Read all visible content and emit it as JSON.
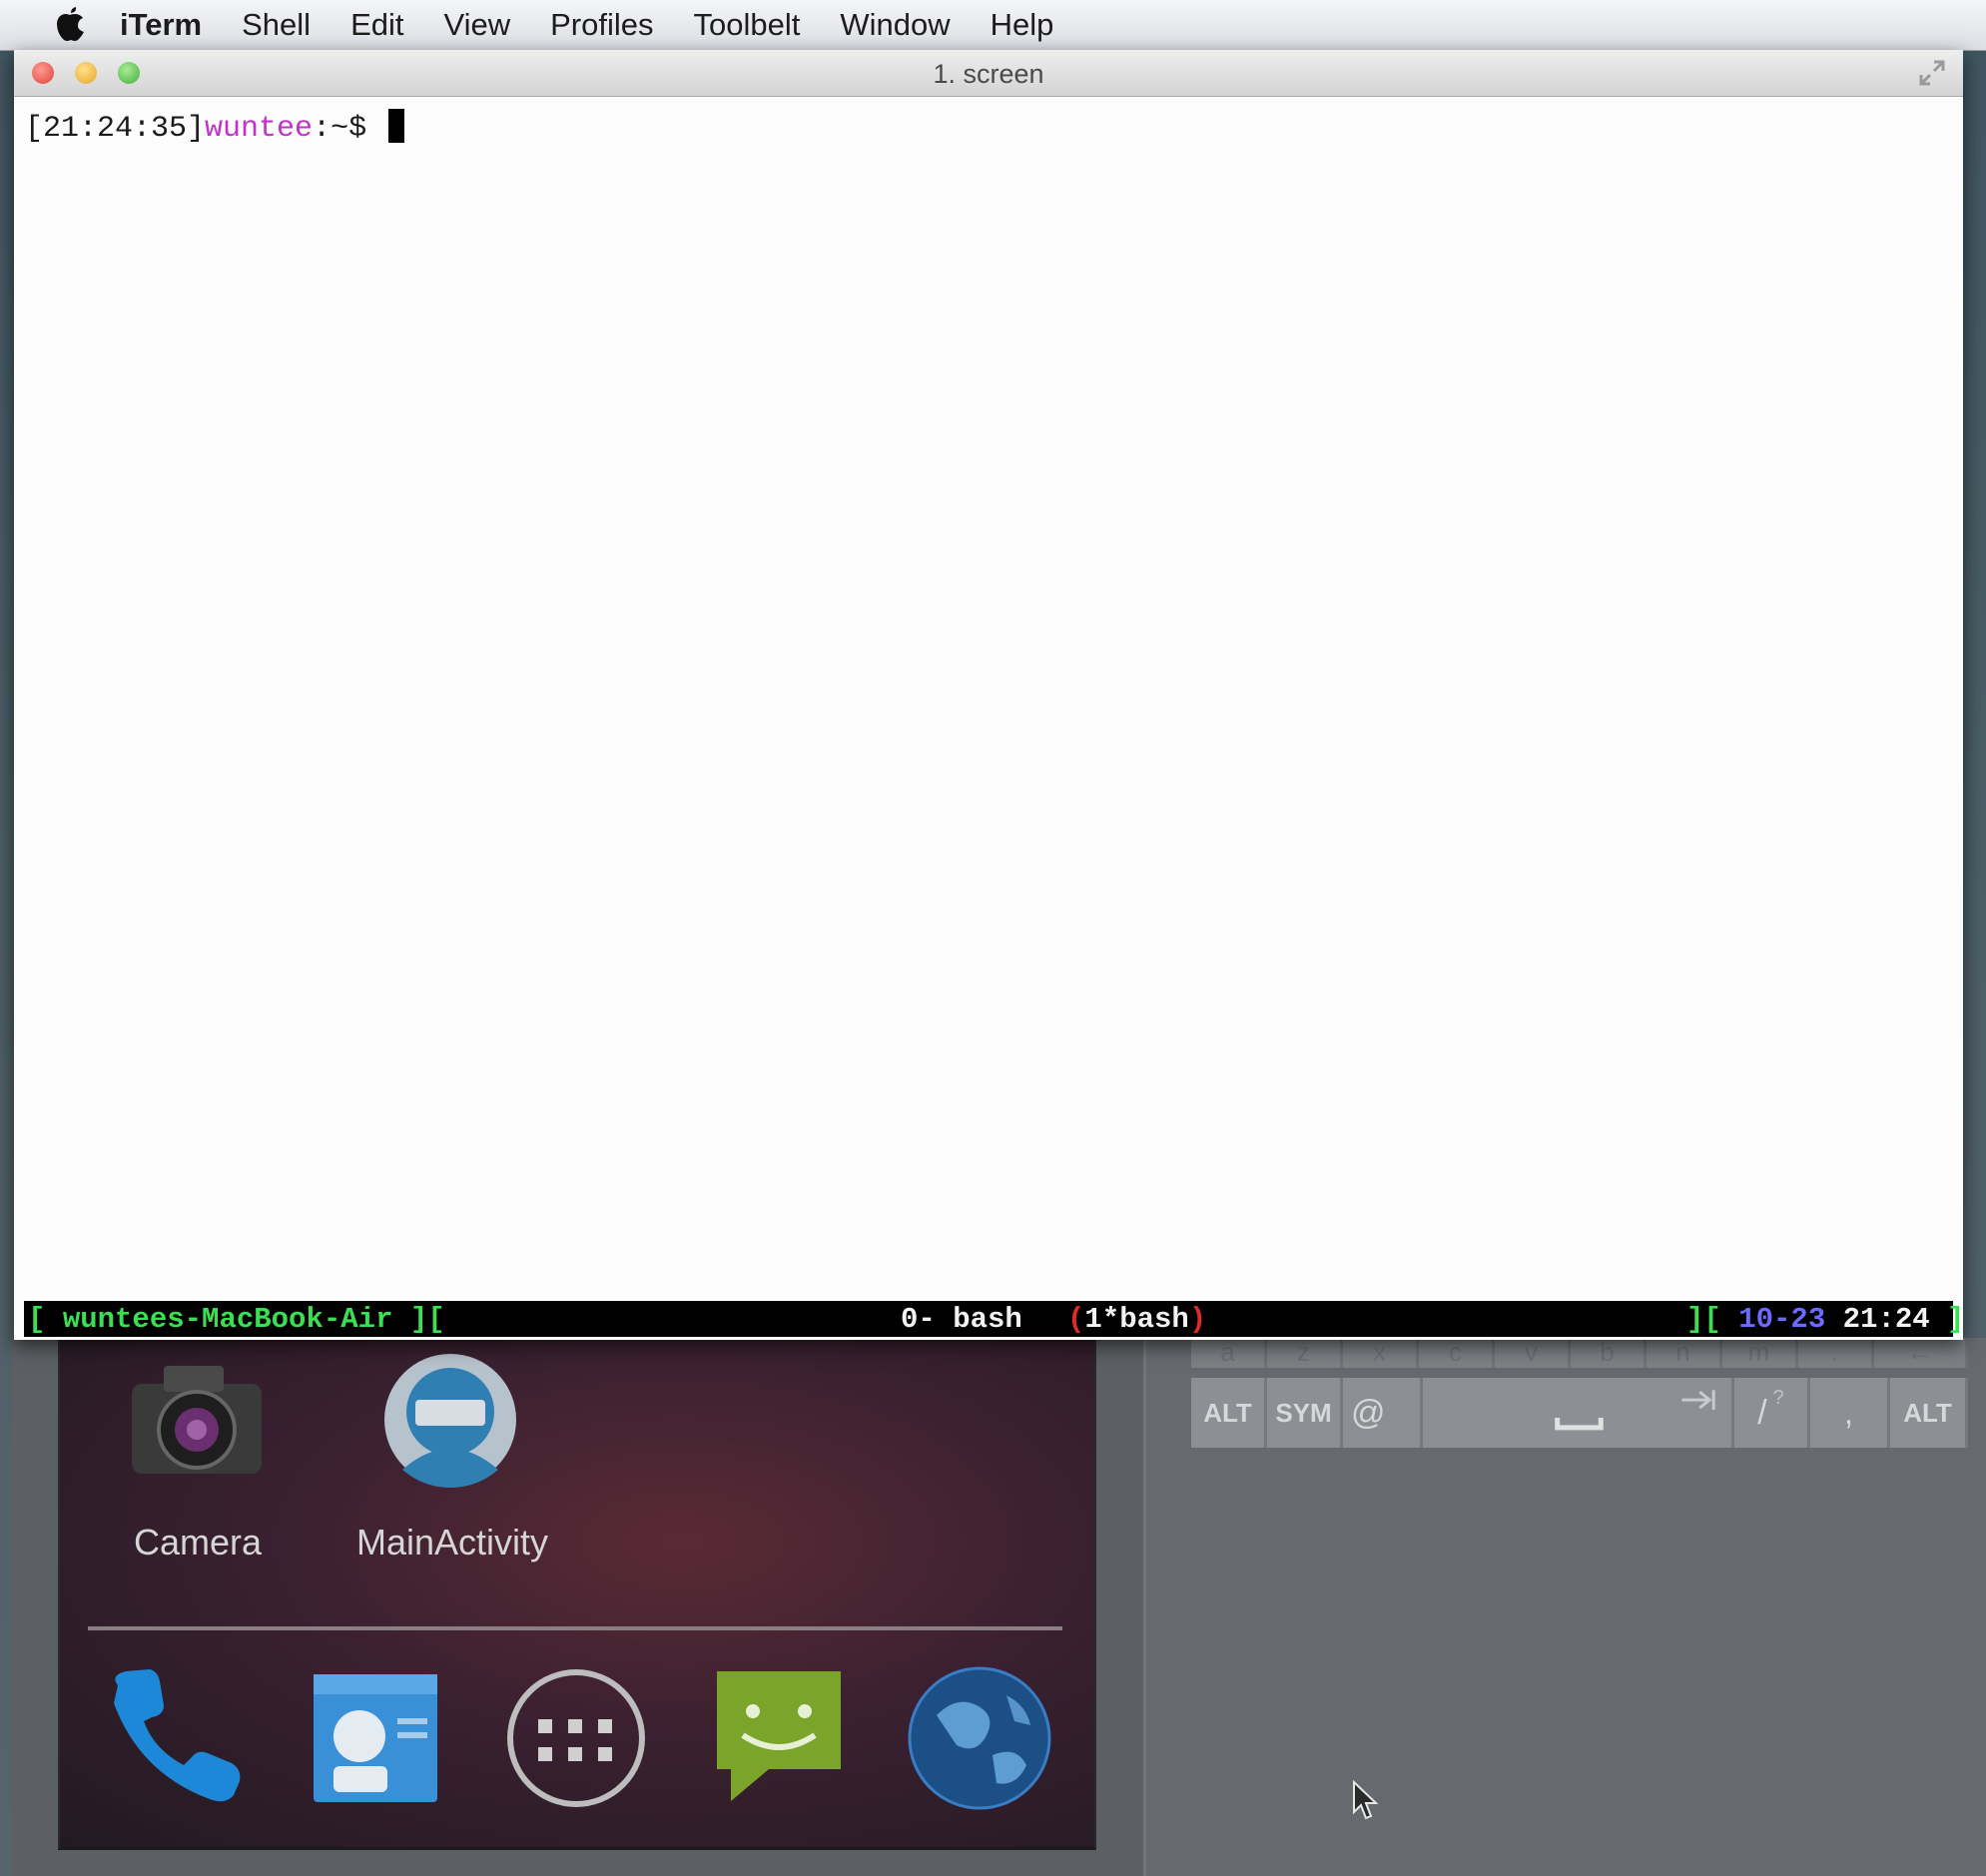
{
  "menubar": {
    "app_name": "iTerm",
    "items": [
      "Shell",
      "Edit",
      "View",
      "Profiles",
      "Toolbelt",
      "Window",
      "Help"
    ]
  },
  "window": {
    "title": "1. screen"
  },
  "terminal": {
    "prompt_time": "[21:24:35]",
    "prompt_user": "wuntee",
    "prompt_suffix": ":~$ "
  },
  "status_bar": {
    "open_bracket": "[ ",
    "hostname": "wuntees-MacBook-Air",
    "hostname_close": " ][",
    "window_0": "0- bash",
    "window_1_open": "(",
    "window_1": "1*bash",
    "window_1_close": ")",
    "right_open": "][ ",
    "date": "10-23",
    "time": "21:24",
    "right_close": " ]"
  },
  "emulator": {
    "apps": [
      {
        "label": "Camera",
        "icon": "camera-icon"
      },
      {
        "label": "MainActivity",
        "icon": "android-person-icon"
      }
    ],
    "dock": [
      "phone-icon",
      "contacts-icon",
      "app-drawer-icon",
      "messaging-icon",
      "browser-globe-icon"
    ],
    "keyboard": {
      "top_row": [
        "a",
        "z",
        "x",
        "c",
        "v",
        "b",
        "n",
        "m",
        ".",
        "←"
      ],
      "alt_left": "ALT",
      "sym": "SYM",
      "at": "@",
      "slash": "/",
      "question": "?",
      "comma": ",",
      "alt_right": "ALT"
    }
  },
  "colors": {
    "prompt_user": "#c132c6",
    "status_green": "#3adf52",
    "status_red": "#e02b2b",
    "status_blue": "#6b6bff",
    "close_light": "#ee5a52",
    "minimize_light": "#f6bd3f",
    "zoom_light": "#5fc453"
  }
}
